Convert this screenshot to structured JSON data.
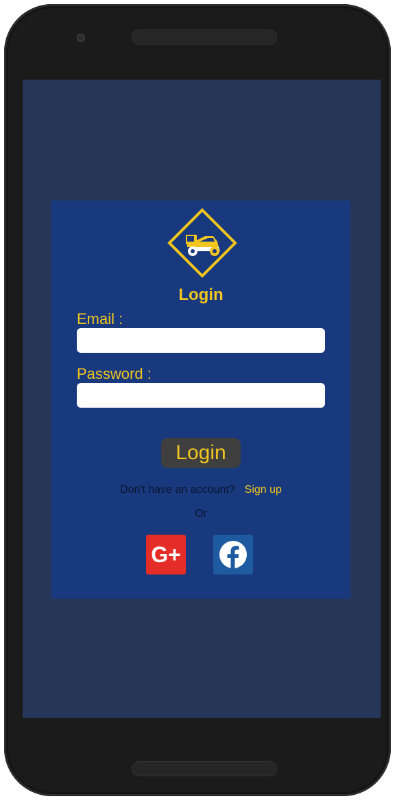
{
  "colors": {
    "screen_bg": "#253659",
    "card_bg": "#19397f",
    "accent": "#f2c61f",
    "button_bg": "#3f3f3f",
    "google_red": "#e52d27",
    "facebook_blue": "#1d5aa0"
  },
  "login_card": {
    "logo_icon": "car-diamond-logo-icon",
    "title": "Login",
    "email_label": "Email :",
    "email_value": "",
    "email_placeholder": "",
    "password_label": "Password :",
    "password_value": "",
    "password_placeholder": "",
    "login_button": "Login",
    "signup_question": "Don't have an account?",
    "signup_link": "Sign up",
    "or_text": "Or",
    "social": [
      {
        "icon": "google-plus-icon",
        "label": "G+"
      },
      {
        "icon": "facebook-icon",
        "label": "f"
      }
    ]
  }
}
